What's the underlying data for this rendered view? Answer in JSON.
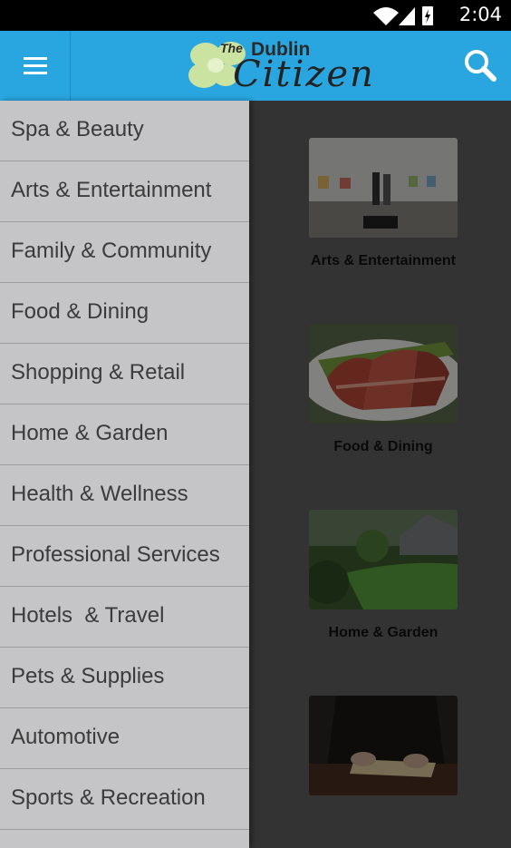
{
  "status": {
    "time": "2:04"
  },
  "appbar": {
    "logo": {
      "the": "The",
      "dublin": "Dublin",
      "citizen": "Citizen"
    },
    "menu_icon": "hamburger-menu-icon",
    "search_icon": "search-icon",
    "accent_color": "#29a6e0"
  },
  "drawer": {
    "items": [
      {
        "label": "Spa & Beauty"
      },
      {
        "label": "Arts & Entertainment"
      },
      {
        "label": "Family & Community"
      },
      {
        "label": "Food & Dining"
      },
      {
        "label": "Shopping & Retail"
      },
      {
        "label": "Home & Garden"
      },
      {
        "label": "Health & Wellness"
      },
      {
        "label": "Professional Services"
      },
      {
        "label": "Hotels  & Travel"
      },
      {
        "label": "Pets & Supplies"
      },
      {
        "label": "Automotive"
      },
      {
        "label": "Sports & Recreation"
      }
    ]
  },
  "content": {
    "cards": [
      {
        "caption": "Arts & Entertainment"
      },
      {
        "caption": "Food & Dining"
      },
      {
        "caption": "Home & Garden"
      },
      {
        "caption": ""
      }
    ]
  }
}
